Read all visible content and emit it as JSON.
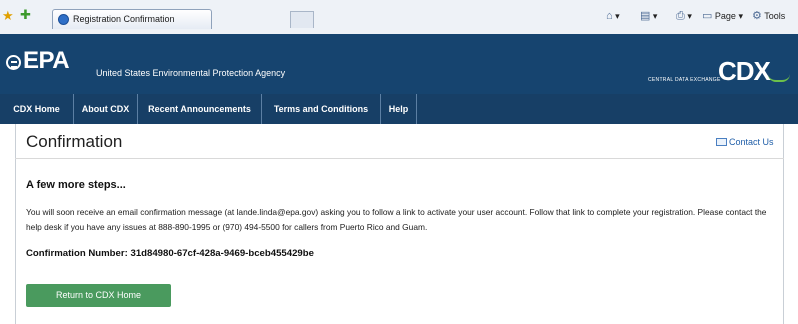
{
  "browser": {
    "tab_title": "Registration Confirmation",
    "toolbar": {
      "home_glyph": "⌂",
      "feeds_glyph": "▤",
      "print_glyph": "⎙",
      "page_label": "Page",
      "tools_label": "Tools",
      "dropdown_glyph": "▾"
    }
  },
  "header": {
    "logo_text": "EPA",
    "agency_name": "United States Environmental Protection Agency",
    "cdx_subtitle": "CENTRAL DATA EXCHANGE",
    "cdx_logo": "CDX"
  },
  "nav": {
    "items": [
      {
        "label": "CDX Home"
      },
      {
        "label": "About CDX"
      },
      {
        "label": "Recent Announcements"
      },
      {
        "label": "Terms and Conditions"
      },
      {
        "label": "Help"
      }
    ]
  },
  "main": {
    "title": "Confirmation",
    "contact_link": "Contact Us",
    "steps_heading": "A few more steps...",
    "message": "You will soon receive an email confirmation message (at lande.linda@epa.gov) asking you to follow a link to activate your user account. Follow that link to complete your registration. Please contact the help desk if you have any issues at 888-890-1995 or (970) 494-5500 for callers from Puerto Rico and Guam.",
    "confirmation_label": "Confirmation Number:",
    "confirmation_number": "31d84980-67cf-428a-9469-bceb455429be",
    "button_label": "Return to CDX Home"
  },
  "colors": {
    "header_bg": "#16446f",
    "nav_bg": "#173f66",
    "button_bg": "#4a9a5e",
    "link": "#1f5ea8"
  }
}
